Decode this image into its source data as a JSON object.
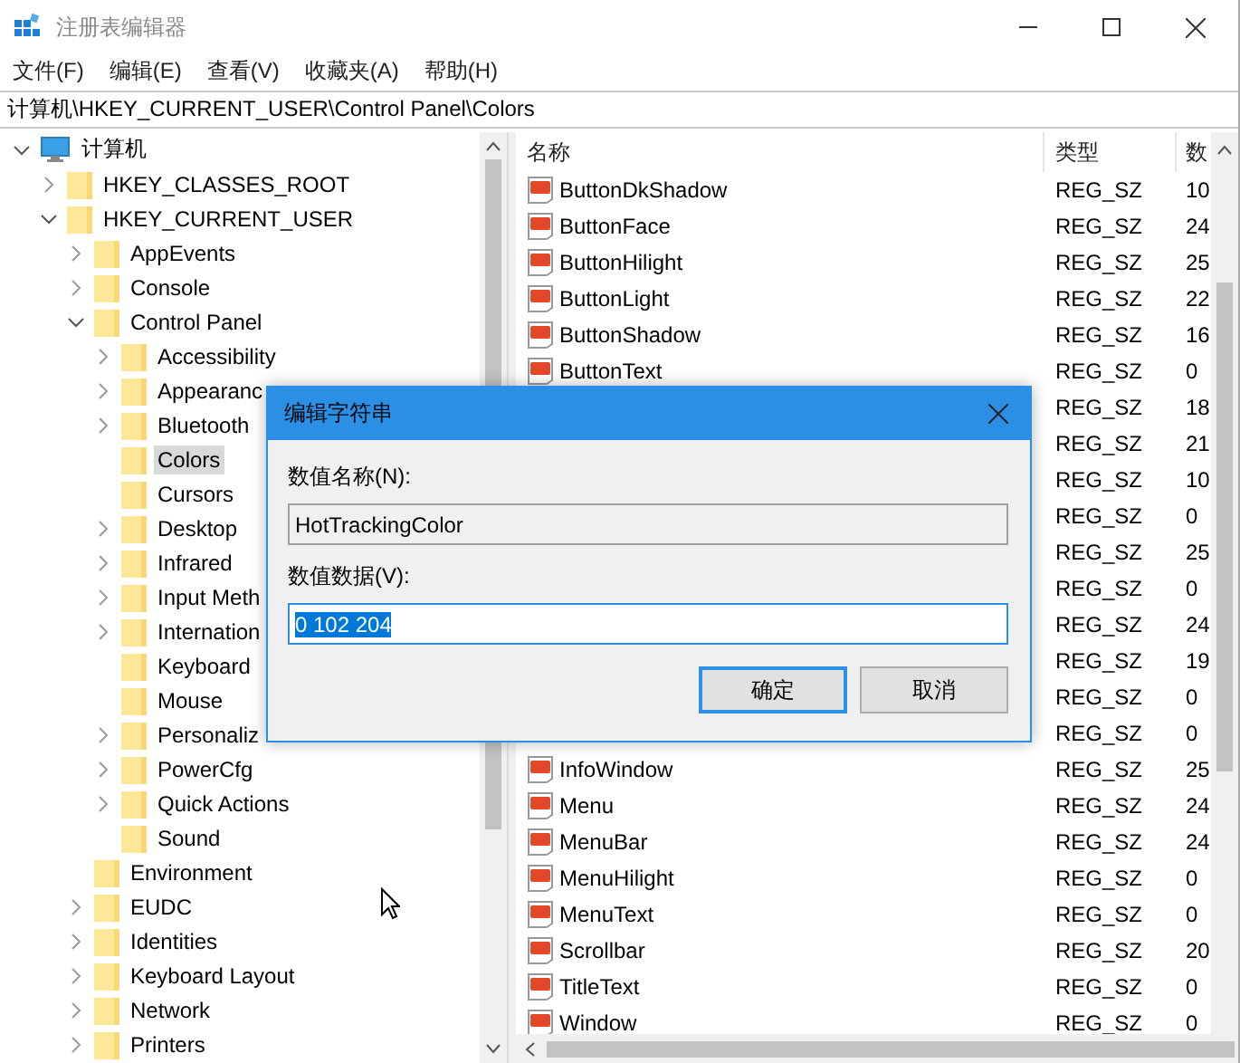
{
  "window": {
    "title": "注册表编辑器"
  },
  "menu": [
    "文件(F)",
    "编辑(E)",
    "查看(V)",
    "收藏夹(A)",
    "帮助(H)"
  ],
  "address": "计算机\\HKEY_CURRENT_USER\\Control Panel\\Colors",
  "tree": [
    {
      "label": "计算机",
      "kind": "computer",
      "expanded": true,
      "selected": false,
      "children": [
        {
          "label": "HKEY_CLASSES_ROOT",
          "expanded": false,
          "selected": false
        },
        {
          "label": "HKEY_CURRENT_USER",
          "expanded": true,
          "selected": false,
          "children": [
            {
              "label": "AppEvents",
              "expanded": false,
              "selected": false
            },
            {
              "label": "Console",
              "expanded": false,
              "selected": false
            },
            {
              "label": "Control Panel",
              "expanded": true,
              "selected": false,
              "children": [
                {
                  "label": "Accessibility",
                  "expanded": false,
                  "selected": false
                },
                {
                  "label": "Appearanc",
                  "expanded": false,
                  "selected": false
                },
                {
                  "label": "Bluetooth",
                  "expanded": false,
                  "selected": false
                },
                {
                  "label": "Colors",
                  "selected": true
                },
                {
                  "label": "Cursors",
                  "selected": false
                },
                {
                  "label": "Desktop",
                  "expanded": false,
                  "selected": false
                },
                {
                  "label": "Infrared",
                  "expanded": false,
                  "selected": false
                },
                {
                  "label": "Input Meth",
                  "expanded": false,
                  "selected": false
                },
                {
                  "label": "Internation",
                  "expanded": false,
                  "selected": false
                },
                {
                  "label": "Keyboard",
                  "selected": false
                },
                {
                  "label": "Mouse",
                  "selected": false
                },
                {
                  "label": "Personaliz",
                  "expanded": false,
                  "selected": false
                },
                {
                  "label": "PowerCfg",
                  "expanded": false,
                  "selected": false
                },
                {
                  "label": "Quick Actions",
                  "expanded": false,
                  "selected": false
                },
                {
                  "label": "Sound",
                  "selected": false
                }
              ]
            },
            {
              "label": "Environment",
              "selected": false
            },
            {
              "label": "EUDC",
              "expanded": false,
              "selected": false
            },
            {
              "label": "Identities",
              "expanded": false,
              "selected": false
            },
            {
              "label": "Keyboard Layout",
              "expanded": false,
              "selected": false
            },
            {
              "label": "Network",
              "expanded": false,
              "selected": false
            },
            {
              "label": "Printers",
              "expanded": false,
              "selected": false
            }
          ]
        }
      ]
    }
  ],
  "list": {
    "columns": [
      "名称",
      "类型",
      "数"
    ],
    "rows": [
      {
        "name": "ButtonDkShadow",
        "type": "REG_SZ",
        "data": "10"
      },
      {
        "name": "ButtonFace",
        "type": "REG_SZ",
        "data": "24"
      },
      {
        "name": "ButtonHilight",
        "type": "REG_SZ",
        "data": "25"
      },
      {
        "name": "ButtonLight",
        "type": "REG_SZ",
        "data": "22"
      },
      {
        "name": "ButtonShadow",
        "type": "REG_SZ",
        "data": "16"
      },
      {
        "name": "ButtonText",
        "type": "REG_SZ",
        "data": "0"
      },
      {
        "type": "REG_SZ",
        "data": "18"
      },
      {
        "type": "REG_SZ",
        "data": "21"
      },
      {
        "type": "REG_SZ",
        "data": "10"
      },
      {
        "type": "REG_SZ",
        "data": "0"
      },
      {
        "type": "REG_SZ",
        "data": "25"
      },
      {
        "type": "REG_SZ",
        "data": "0"
      },
      {
        "type": "REG_SZ",
        "data": "24"
      },
      {
        "type": "REG_SZ",
        "data": "19"
      },
      {
        "type": "REG_SZ",
        "data": "0"
      },
      {
        "type": "REG_SZ",
        "data": "0"
      },
      {
        "name": "InfoWindow",
        "type": "REG_SZ",
        "data": "25"
      },
      {
        "name": "Menu",
        "type": "REG_SZ",
        "data": "24"
      },
      {
        "name": "MenuBar",
        "type": "REG_SZ",
        "data": "24"
      },
      {
        "name": "MenuHilight",
        "type": "REG_SZ",
        "data": "0"
      },
      {
        "name": "MenuText",
        "type": "REG_SZ",
        "data": "0"
      },
      {
        "name": "Scrollbar",
        "type": "REG_SZ",
        "data": "20"
      },
      {
        "name": "TitleText",
        "type": "REG_SZ",
        "data": "0"
      },
      {
        "name": "Window",
        "type": "REG_SZ",
        "data": "0"
      }
    ]
  },
  "dialog": {
    "title": "编辑字符串",
    "name_label": "数值名称(N):",
    "name_value": "HotTrackingColor",
    "data_label": "数值数据(V):",
    "data_value": "0 102 204",
    "buttons": [
      {
        "label": "确定",
        "default": true
      },
      {
        "label": "取消",
        "default": false
      }
    ]
  }
}
